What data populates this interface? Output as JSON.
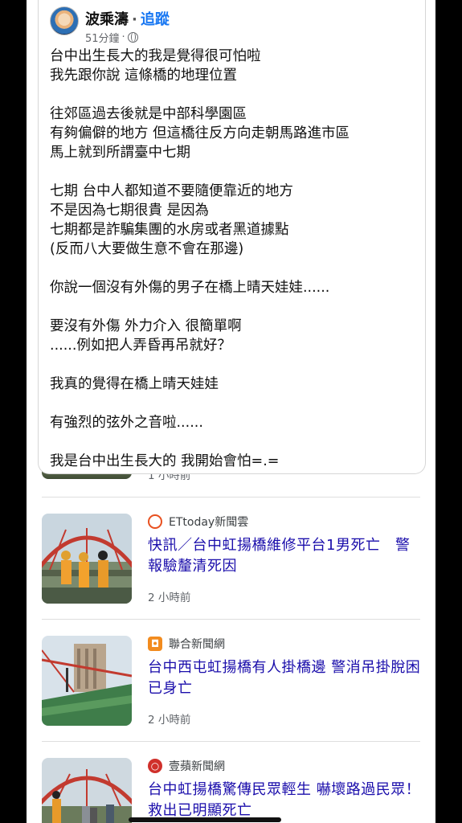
{
  "post": {
    "author": "波乘濤",
    "separator": "·",
    "follow_label": "追蹤",
    "time": "51分鐘",
    "time_separator": "·",
    "privacy_icon": "globe-icon",
    "lines": [
      "台中出生長大的我是覺得很可怕啦",
      "我先跟你說 這條橋的地理位置",
      "",
      "往郊區過去後就是中部科學園區",
      "有夠偏僻的地方 但這橋往反方向走朝馬路進市區",
      "馬上就到所謂臺中七期",
      "",
      "七期 台中人都知道不要隨便靠近的地方",
      "不是因為七期很貴 是因為",
      "七期都是詐騙集團的水房或者黑道據點",
      "(反而八大要做生意不會在那邊)",
      "",
      "你說一個沒有外傷的男子在橋上晴天娃娃......",
      "",
      "要沒有外傷 外力介入 很簡單啊",
      "......例如把人弄昏再吊就好？",
      "",
      "我真的覺得在橋上晴天娃娃",
      "",
      "有強烈的弦外之音啦......",
      "",
      "我是台中出生長大的 我開始會怕=.="
    ]
  },
  "partial_item": {
    "time": "1 小時前"
  },
  "news": [
    {
      "source": "ETtoday新聞雲",
      "source_icon": "ettoday-icon",
      "source_color": "#e8501f",
      "headline": "快訊／台中虹揚橋維修平台1男死亡　警報驗釐清死因",
      "time": "2 小時前"
    },
    {
      "source": "聯合新聞網",
      "source_icon": "udn-icon",
      "source_color": "#f28b1e",
      "headline": "台中西屯虹揚橋有人掛橋邊 警消吊掛脫困已身亡",
      "time": "2 小時前"
    },
    {
      "source": "壹蘋新聞網",
      "source_icon": "nextapple-icon",
      "source_color": "#d0302b",
      "headline": "台中虹揚橋驚傳民眾輕生 嚇壞路過民眾！救出已明顯死亡",
      "time": ""
    }
  ]
}
